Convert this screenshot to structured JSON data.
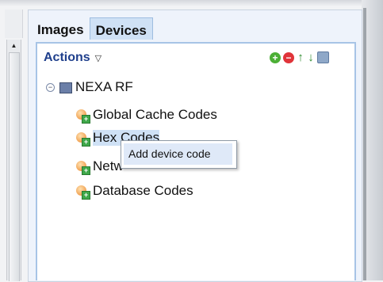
{
  "tabs": [
    {
      "label": "Images",
      "active": false
    },
    {
      "label": "Devices",
      "active": true
    }
  ],
  "actions": {
    "label": "Actions",
    "caret_icon": "triangle-down-icon"
  },
  "toolbar": {
    "icons": [
      "add-icon",
      "remove-icon",
      "move-up-icon",
      "move-down-icon",
      "save-icon"
    ],
    "add_glyph": "+",
    "remove_glyph": "−",
    "up_glyph": "↑",
    "down_glyph": "↓"
  },
  "tree": {
    "root": {
      "label": "NEXA RF",
      "expander": "⊖"
    },
    "items": [
      {
        "label": "Global Cache Codes",
        "selected": false
      },
      {
        "label": "Hex Codes",
        "selected": true
      },
      {
        "label": "Netw",
        "selected": false
      },
      {
        "label": "Database Codes",
        "selected": false
      }
    ]
  },
  "context_menu": {
    "items": [
      {
        "label": "Add device code"
      }
    ]
  },
  "scrollbar": {
    "up_arrow": "▲"
  },
  "colors": {
    "accent": "#1f3f8c",
    "selection": "#cfe1f5",
    "panel_border": "#a7c4e6"
  }
}
